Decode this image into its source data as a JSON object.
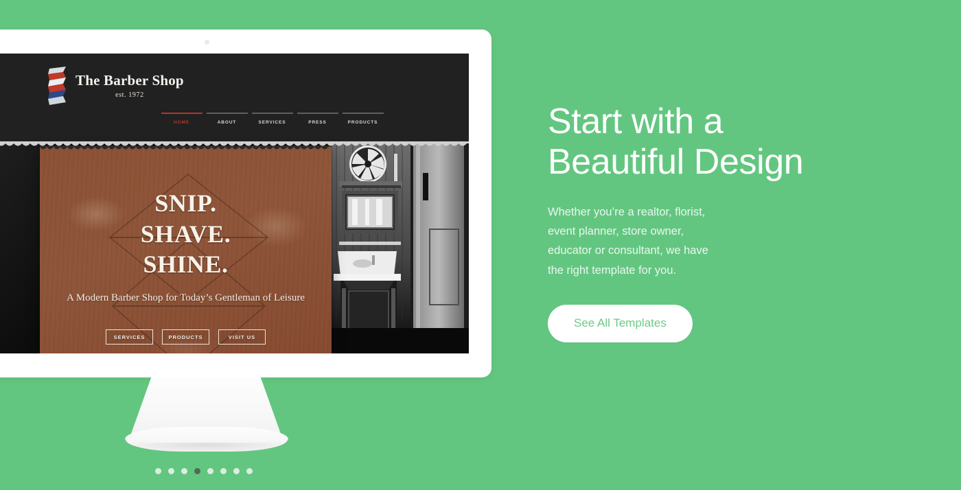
{
  "theme": {
    "background_green": "#63c680",
    "cta_text_green": "#6dc985",
    "nav_active_red": "#b5342c",
    "hero_card_brown": "#8d5236",
    "screen_black": "#1d1d1d",
    "monitor_white": "#ffffff"
  },
  "promo": {
    "title_line1": "Start with a",
    "title_line2": "Beautiful Design",
    "paragraph_lines": [
      "Whether you’re a realtor, florist,",
      "event planner, store owner,",
      "educator or consultant, we have",
      "the right template for you."
    ],
    "cta_label": "See All Templates"
  },
  "template_preview": {
    "brand": {
      "name": "The Barber Shop",
      "established": "est. 1972",
      "logo_icon": "barber-ribbon-icon"
    },
    "nav": [
      {
        "label": "HOME",
        "active": true
      },
      {
        "label": "ABOUT",
        "active": false
      },
      {
        "label": "SERVICES",
        "active": false
      },
      {
        "label": "PRESS",
        "active": false
      },
      {
        "label": "PRODUCTS",
        "active": false
      }
    ],
    "hero": {
      "headline_lines": [
        "SNIP.",
        "SHAVE.",
        "SHINE."
      ],
      "subhead_lines": [
        "A Modern Barber Shop",
        "for Today’s Gentleman of Leisure"
      ],
      "buttons": [
        "SERVICES",
        "PRODUCTS",
        "VISIT US"
      ]
    },
    "photos": {
      "left_alt": "barber-pole-photo",
      "right_alt": "vintage-barbershop-interior-photo"
    }
  },
  "device": {
    "camera_icon": "webcam-dot-icon",
    "stand_icon": "monitor-stand"
  },
  "carousel": {
    "total_slides": 8,
    "active_index": 4,
    "dots": [
      {
        "index": 1,
        "active": false
      },
      {
        "index": 2,
        "active": false
      },
      {
        "index": 3,
        "active": false
      },
      {
        "index": 4,
        "active": true
      },
      {
        "index": 5,
        "active": false
      },
      {
        "index": 6,
        "active": false
      },
      {
        "index": 7,
        "active": false
      },
      {
        "index": 8,
        "active": false
      }
    ]
  }
}
